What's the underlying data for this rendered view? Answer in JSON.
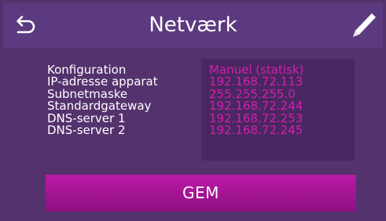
{
  "header": {
    "title": "Netværk",
    "back_icon": "undo-arrow-icon",
    "edit_icon": "pencil-icon"
  },
  "network": {
    "rows": [
      {
        "label": "Konfiguration",
        "value": "Manuel (statisk)"
      },
      {
        "label": "IP-adresse apparat",
        "value": "192.168.72.113"
      },
      {
        "label": "Subnetmaske",
        "value": "255.255.255.0"
      },
      {
        "label": "Standardgateway",
        "value": "192.168.72.244"
      },
      {
        "label": "DNS-server 1",
        "value": "192.168.72.253"
      },
      {
        "label": "DNS-server 2",
        "value": "192.168.72.245"
      }
    ]
  },
  "actions": {
    "save_label": "GEM"
  },
  "colors": {
    "background": "#54326e",
    "header": "#5c3a80",
    "value_panel": "#4a2761",
    "value_text": "#d21fae",
    "accent_button": "#a81596"
  }
}
